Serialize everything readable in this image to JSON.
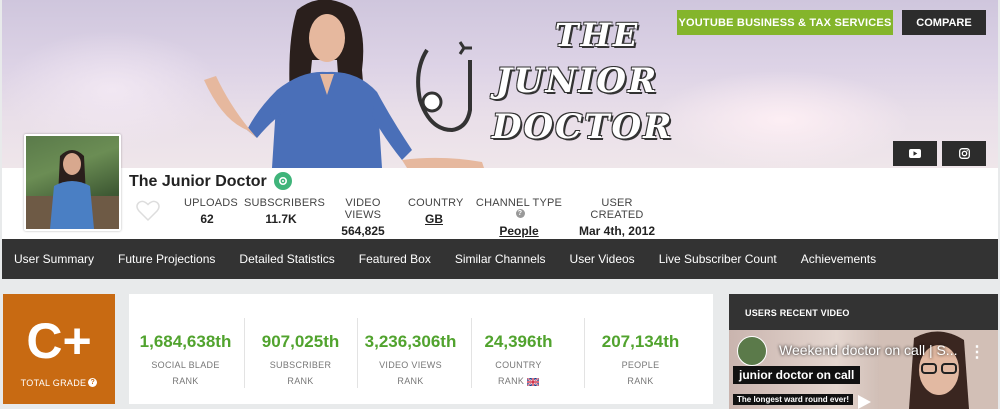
{
  "banner": {
    "logo_line1": "THE",
    "logo_line2": "JUNIOR",
    "logo_line3": "DOCTOR"
  },
  "header_buttons": {
    "business_label": "YOUTUBE BUSINESS & TAX SERVICES",
    "compare_label": "COMPARE"
  },
  "social": {
    "youtube_icon": "youtube-icon",
    "instagram_icon": "instagram-icon"
  },
  "channel": {
    "name": "The Junior Doctor"
  },
  "stats": [
    {
      "label": "UPLOADS",
      "value": "62"
    },
    {
      "label": "SUBSCRIBERS",
      "value": "11.7K"
    },
    {
      "label": "VIDEO VIEWS",
      "value": "564,825"
    },
    {
      "label": "COUNTRY",
      "value": "GB"
    },
    {
      "label": "CHANNEL TYPE",
      "value": "People"
    },
    {
      "label": "USER CREATED",
      "value": "Mar 4th, 2012"
    }
  ],
  "nav": [
    "User Summary",
    "Future Projections",
    "Detailed Statistics",
    "Featured Box",
    "Similar Channels",
    "User Videos",
    "Live Subscriber Count",
    "Achievements"
  ],
  "grade": {
    "value": "C+",
    "label": "TOTAL GRADE"
  },
  "ranks": [
    {
      "value": "1,684,638th",
      "line1": "SOCIAL BLADE",
      "line2": "RANK"
    },
    {
      "value": "907,025th",
      "line1": "SUBSCRIBER",
      "line2": "RANK"
    },
    {
      "value": "3,236,306th",
      "line1": "VIDEO VIEWS",
      "line2": "RANK"
    },
    {
      "value": "24,396th",
      "line1": "COUNTRY",
      "line2": "RANK"
    },
    {
      "value": "207,134th",
      "line1": "PEOPLE",
      "line2": "RANK"
    }
  ],
  "recent_video": {
    "header": "USERS RECENT VIDEO",
    "title": "Weekend doctor on call | S...",
    "overlay_text": "junior doctor on call",
    "overlay_subtext": "The longest ward round ever!"
  },
  "colors": {
    "accent_green": "#84b52b",
    "rank_green": "#51a32e",
    "grade_orange": "#c86a12",
    "nav_dark": "#333333"
  }
}
